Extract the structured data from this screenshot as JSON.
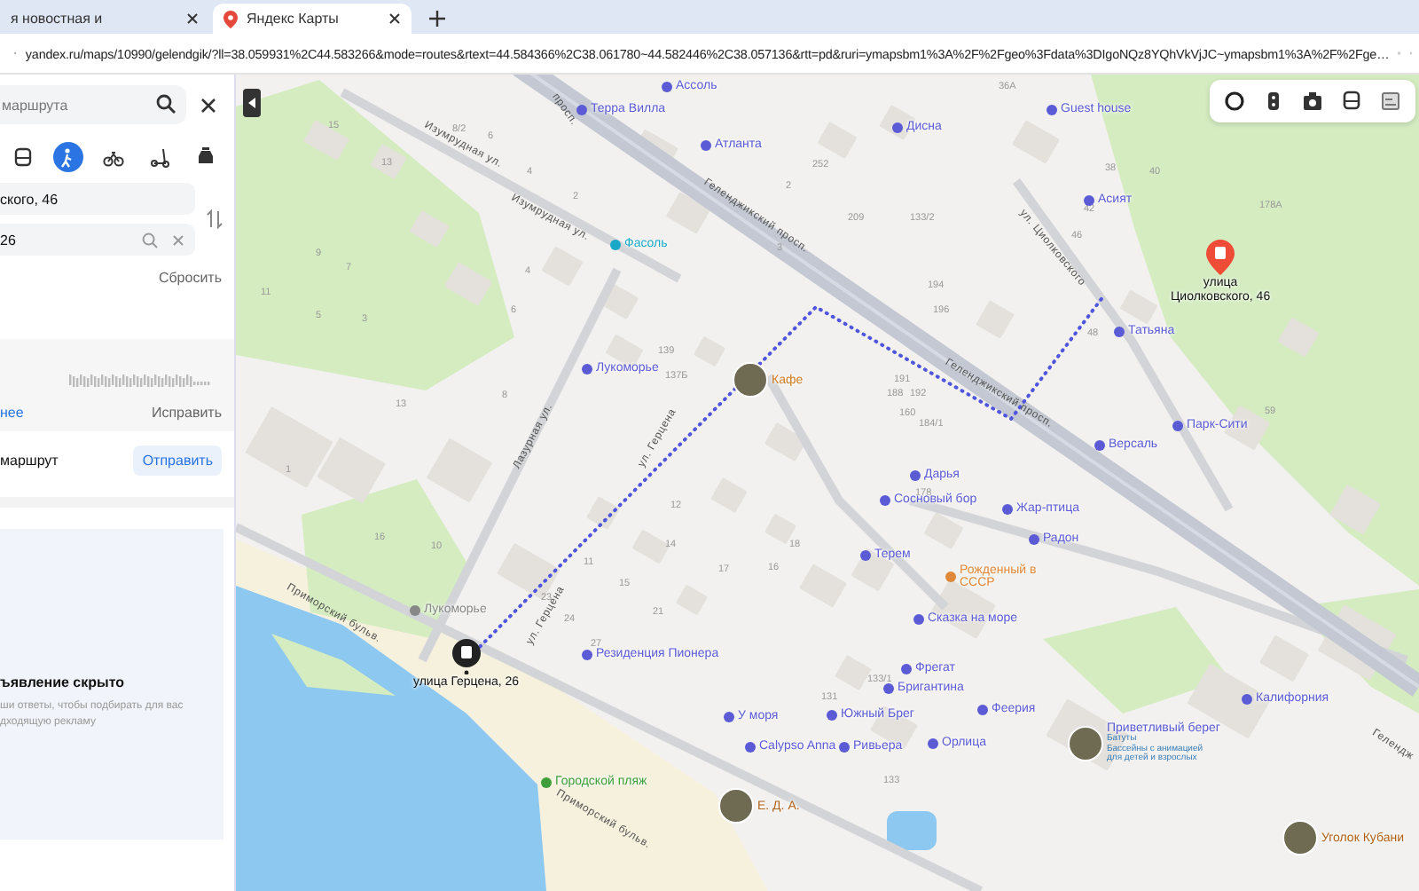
{
  "browser": {
    "tabs": [
      {
        "label": "я новостная и",
        "selected": false
      },
      {
        "label": "Яндекс Карты",
        "selected": true
      }
    ],
    "url": "yandex.ru/maps/10990/gelendgik/?ll=38.059931%2C44.583266&mode=routes&rtext=44.584366%2C38.061780~44.582446%2C38.057136&rtt=pd&ruri=ymapsbm1%3A%2F%2Fgeo%3Fdata%3DIgoNQz8YQhVkVjJC~ymapsbm1%3A%2F%2Fge…"
  },
  "panel": {
    "search": {
      "placeholder": "маршрута"
    },
    "modes": [
      {
        "kind": "bus",
        "selected": false
      },
      {
        "kind": "walk",
        "selected": true
      },
      {
        "kind": "bike",
        "selected": false
      },
      {
        "kind": "scooter",
        "selected": false
      },
      {
        "kind": "taxi",
        "selected": false
      }
    ],
    "from": "ского, 46",
    "to": "26",
    "reset": "Сбросить",
    "more": "нее",
    "fix": "Исправить",
    "send_label": "маршрут",
    "send": "Отправить",
    "ad_title": "ъявление скрыто",
    "ad_text": "ши ответы, чтобы подбирать для вас\nдходящую рекламу"
  },
  "map": {
    "streets": [
      "Изумрудная ул.",
      "Изумрудная ул.",
      "просп.",
      "Геленджикский просп.",
      "Геленджикский просп.",
      "Гелендж",
      "ул. Циолковского",
      "Лазурная ул.",
      "ул. Герцена",
      "ул. Герцена",
      "Приморский бульв.",
      "Приморский бульв."
    ],
    "houses": [
      "15",
      "13",
      "8/2",
      "6",
      "4",
      "2",
      "11",
      "9",
      "7",
      "5",
      "3",
      "1",
      "10",
      "16",
      "13",
      "139",
      "137Б",
      "252",
      "209",
      "2",
      "3",
      "4",
      "6",
      "8",
      "12",
      "14",
      "15",
      "17",
      "23",
      "24",
      "21",
      "27",
      "11",
      "18",
      "16",
      "36А",
      "38",
      "40",
      "42",
      "46",
      "48",
      "59",
      "192",
      "184/1",
      "196",
      "194",
      "191",
      "188",
      "160",
      "178",
      "178А",
      "133/2",
      "133/1",
      "131",
      "133"
    ],
    "places": [
      {
        "name": "Терра Вилла",
        "kind": "hotel"
      },
      {
        "name": "Ассоль",
        "kind": "hotel"
      },
      {
        "name": "Атланта",
        "kind": "hotel"
      },
      {
        "name": "Дисна",
        "kind": "hotel"
      },
      {
        "name": "Guest house",
        "kind": "hotel"
      },
      {
        "name": "Асият",
        "kind": "hotel"
      },
      {
        "name": "Фасоль",
        "kind": "shop"
      },
      {
        "name": "Лукоморье",
        "kind": "hotel"
      },
      {
        "name": "Кафе",
        "kind": "featured"
      },
      {
        "name": "Татьяна",
        "kind": "hotel"
      },
      {
        "name": "Версаль",
        "kind": "hotel"
      },
      {
        "name": "Парк-Сити",
        "kind": "hotel"
      },
      {
        "name": "Дарья",
        "kind": "hotel"
      },
      {
        "name": "Сосновый бор",
        "kind": "hotel"
      },
      {
        "name": "Жар-птица",
        "kind": "hotel"
      },
      {
        "name": "Радон",
        "kind": "hotel"
      },
      {
        "name": "Терем",
        "kind": "hotel"
      },
      {
        "name": "Рожденный в СССР",
        "kind": "food"
      },
      {
        "name": "Сказка на море",
        "kind": "hotel"
      },
      {
        "name": "Фрегат",
        "kind": "hotel"
      },
      {
        "name": "Бригантина",
        "kind": "hotel"
      },
      {
        "name": "Южный Брег",
        "kind": "hotel"
      },
      {
        "name": "Ривьера",
        "kind": "hotel"
      },
      {
        "name": "Орлица",
        "kind": "hotel"
      },
      {
        "name": "Феерия",
        "kind": "hotel"
      },
      {
        "name": "Калифорния",
        "kind": "hotel"
      },
      {
        "name": "У моря",
        "kind": "hotel"
      },
      {
        "name": "Calypso Anna",
        "kind": "hotel"
      },
      {
        "name": "Резиденция Пионера",
        "kind": "hotel"
      },
      {
        "name": "Лукоморье",
        "kind": "park"
      },
      {
        "name": "Городской пляж",
        "kind": "beach"
      },
      {
        "name": "Приветливый берег",
        "kind": "featured",
        "sub": "Батуты\nБассейны с анимацией\nдля детей и взрослых"
      },
      {
        "name": "Е. Д. А.",
        "kind": "featured"
      },
      {
        "name": "Уголок Кубани",
        "kind": "featured"
      }
    ],
    "pins": [
      {
        "label": "улица\nЦиолковского, 46",
        "kind": "end"
      },
      {
        "label": "улица Герцена, 26",
        "kind": "start"
      }
    ],
    "toolbar": [
      {
        "kind": "layers"
      },
      {
        "kind": "traffic"
      },
      {
        "kind": "panorama"
      },
      {
        "kind": "transit"
      },
      {
        "kind": "ruler"
      }
    ]
  }
}
